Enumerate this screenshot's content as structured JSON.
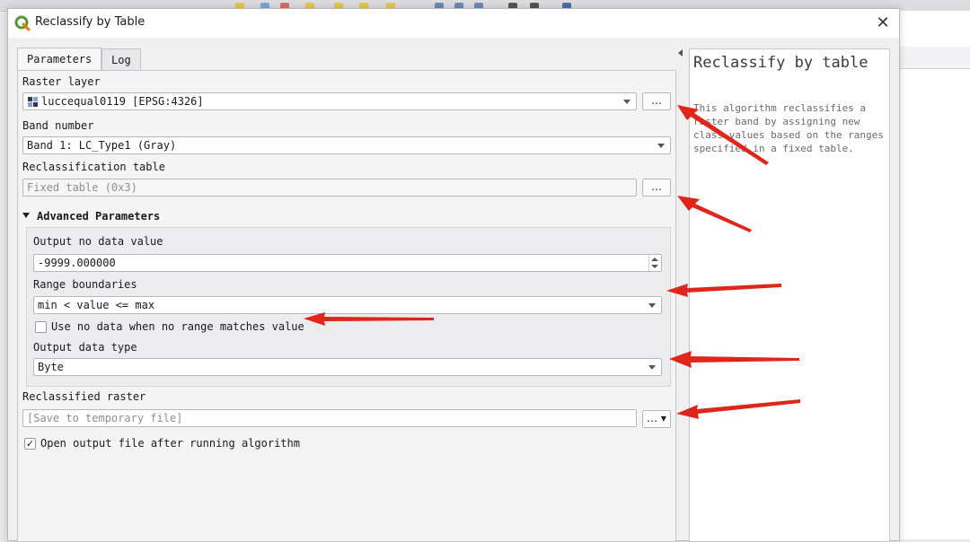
{
  "window": {
    "title": "Reclassify by Table",
    "close_glyph": "✕"
  },
  "tabs": [
    {
      "label": "Parameters",
      "active": true
    },
    {
      "label": "Log",
      "active": false
    }
  ],
  "params": {
    "raster_layer": {
      "label": "Raster layer",
      "value": "luccequal0119 [EPSG:4326]",
      "icon": "raster-layer-icon"
    },
    "band_number": {
      "label": "Band number",
      "value": "Band 1: LC_Type1 (Gray)"
    },
    "reclass_table": {
      "label": "Reclassification table",
      "placeholder": "Fixed table (0x3)"
    },
    "advanced": {
      "header": "Advanced Parameters",
      "output_nodata": {
        "label": "Output no data value",
        "value": "-9999.000000"
      },
      "range_boundaries": {
        "label": "Range boundaries",
        "value": "min < value <= max"
      },
      "use_nodata": {
        "label": "Use no data when no range matches value",
        "checked": false
      },
      "output_type": {
        "label": "Output data type",
        "value": "Byte"
      }
    },
    "reclassified_raster": {
      "label": "Reclassified raster",
      "placeholder": "[Save to temporary file]"
    },
    "open_output": {
      "label": "Open output file after running algorithm",
      "checked": true,
      "check_glyph": "✓"
    }
  },
  "buttons": {
    "browse_label": "…",
    "browse_menu_label": "… ▾"
  },
  "help": {
    "title": "Reclassify by table",
    "body": "This algorithm reclassifies a raster band by assigning new class values based on the ranges specified in a fixed table."
  },
  "colors": {
    "annotation_arrow": "#e0261b",
    "qgis_logo_green": "#589632",
    "qgis_logo_yellow": "#ee7913"
  }
}
